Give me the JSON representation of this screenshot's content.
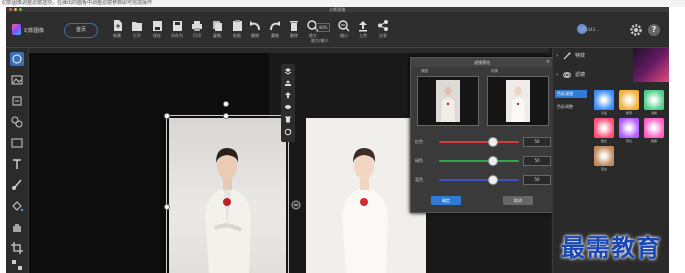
{
  "window": {
    "title": "幻影图像",
    "top_strip_text": "幻影图像调整滤镜选项，在弹出的面板中调整滤镜参数即可完成操作"
  },
  "app": {
    "name": "幻影图像",
    "home_label": "首页"
  },
  "toolbar": {
    "items": [
      {
        "icon": "new-file-icon",
        "label": "新建"
      },
      {
        "icon": "open-folder-icon",
        "label": "打开"
      },
      {
        "icon": "save-icon",
        "label": "保存"
      },
      {
        "icon": "save-as-icon",
        "label": "另存为"
      },
      {
        "icon": "print-icon",
        "label": "打印"
      },
      {
        "icon": "copy-icon",
        "label": "复制"
      },
      {
        "icon": "paste-icon",
        "label": "粘贴"
      },
      {
        "icon": "undo-icon",
        "label": "撤销"
      },
      {
        "icon": "redo-icon",
        "label": "重做"
      },
      {
        "icon": "delete-icon",
        "label": "删除"
      },
      {
        "icon": "zoom-in-icon",
        "label": "放大"
      },
      {
        "icon": "zoom-out-icon",
        "label": "缩小"
      },
      {
        "icon": "upload-icon",
        "label": "上传"
      },
      {
        "icon": "share-icon",
        "label": "分享"
      }
    ],
    "zoom_value": "40%",
    "zoom_label": "放大/缩小",
    "user_name": "151443..."
  },
  "dialog": {
    "title": "滤镜预览",
    "before_label": "原图",
    "after_label": "效果",
    "sliders": [
      {
        "name": "红色",
        "value": "50",
        "color": "#d33b3b",
        "fraction": 0.66
      },
      {
        "name": "绿色",
        "value": "50",
        "color": "#2fa84a",
        "fraction": 0.66
      },
      {
        "name": "蓝色",
        "value": "50",
        "color": "#3c52c8",
        "fraction": 0.66
      }
    ],
    "ok_label": "确定",
    "cancel_label": "取消"
  },
  "right_panel": {
    "sections": [
      {
        "label": "特效",
        "expanded": false
      },
      {
        "label": "滤镜",
        "expanded": true
      }
    ],
    "categories": [
      "色彩滤镜",
      "色彩调整"
    ],
    "filters": [
      {
        "label": "冷蓝",
        "color": "#3b8cff"
      },
      {
        "label": "暖黄",
        "color": "#f0b23a"
      },
      {
        "label": "清新",
        "color": "#4fd08a"
      },
      {
        "label": "暖红",
        "color": "#ff4f7a"
      },
      {
        "label": "梦幻",
        "color": "#b25cff"
      },
      {
        "label": "艳丽",
        "color": "#ff5fc4"
      },
      {
        "label": "复古",
        "color": "#c08a5a"
      }
    ]
  },
  "watermark": "最需教育"
}
